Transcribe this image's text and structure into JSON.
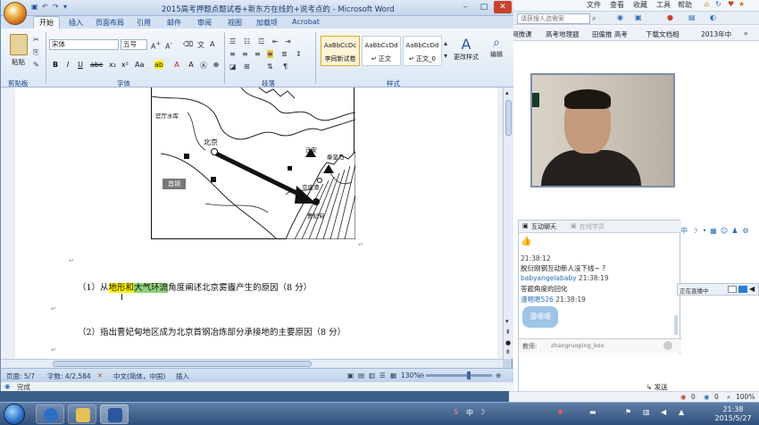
{
  "browser": {
    "menu": [
      "文件",
      "查看",
      "收藏",
      "工具",
      "帮助"
    ],
    "search_placeholder": "请获搜人选需案",
    "favorites": [
      "网微课",
      "高考地理题",
      "田僱推 高考",
      "下载文档相",
      "2013年中"
    ],
    "help": "帮助",
    "status_right": [
      "0",
      "0",
      "100%"
    ]
  },
  "chat": {
    "tab_active": "互动聊天",
    "tab_inactive": "在线学员",
    "messages": [
      {
        "who": "",
        "time": "21:38:12",
        "text": "脱衍刚钢互动新人没下线~ ?"
      },
      {
        "who": "babyangelababy",
        "time": "21:38:19",
        "text": "答题角度的回化"
      },
      {
        "who": "漫嗯嗯526",
        "time": "21:38:19",
        "text": ""
      }
    ],
    "sticker": "漫嗯嗯",
    "teacher_label": "教师:",
    "teacher_name": "zhangruoping_koo",
    "live_text": "正在直播中",
    "send": "发送"
  },
  "word": {
    "title": "2015高考押题点题试卷+新东方在线的+说考点的 - Microsoft Word",
    "tabs": [
      "开始",
      "插入",
      "页面布局",
      "引用",
      "邮件",
      "审阅",
      "视图",
      "加载项",
      "Acrobat"
    ],
    "font_name": "宋体",
    "font_size": "五号",
    "groups": [
      "剪贴板",
      "字体",
      "段落",
      "样式",
      "编辑"
    ],
    "paste": "粘贴",
    "styles": [
      {
        "sample": "AaBbCcDc",
        "name": "李同新试卷"
      },
      {
        "sample": "AaBbCcDd",
        "name": "↵ 正文"
      },
      {
        "sample": "AaBbCcDd",
        "name": "↵ 正文_0"
      }
    ],
    "change_styles": "更改样式",
    "edit": "编辑",
    "map_labels": {
      "guanting": "官厅水库",
      "beijing": "北京",
      "qian_an": "迁安",
      "qinhuangdao": "秦皇岛",
      "jingtang": "京唐港",
      "caofeidian": "曹妃甸",
      "shougang": "首钢"
    },
    "q1_prefix": "（1）从",
    "q1_hl1": "地形和",
    "q1_hl2": "大气环流",
    "q1_rest": "角度阐述北京雾霾产生的原因（8 分）",
    "q2": "（2）指出曹妃甸地区成为北京首钢冶炼部分承接地的主要原因（8 分）",
    "status": {
      "page": "页面: 5/7",
      "words": "字数: 4/2,584",
      "lang": "中文(简体，中国)",
      "mode": "插入",
      "zoom": "130%"
    },
    "done": "完成"
  },
  "taskbar": {
    "time": "21:38",
    "date": "2015/5/27"
  }
}
